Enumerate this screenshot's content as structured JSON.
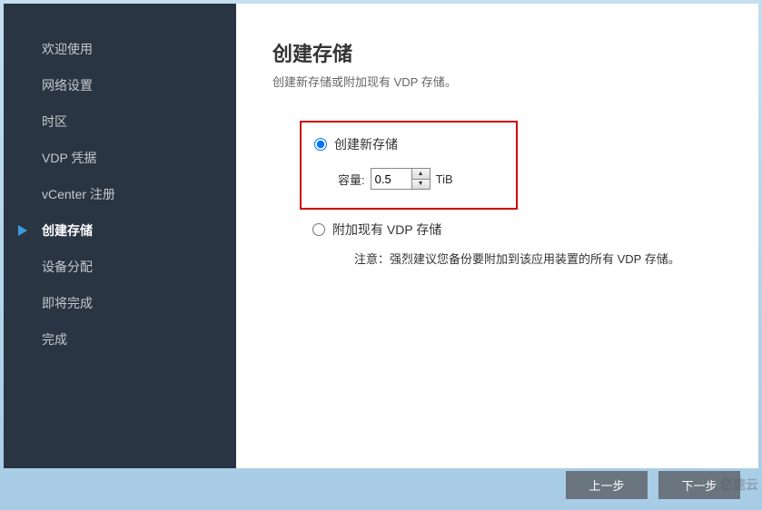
{
  "sidebar": {
    "items": [
      {
        "label": "欢迎使用"
      },
      {
        "label": "网络设置"
      },
      {
        "label": "时区"
      },
      {
        "label": "VDP 凭据"
      },
      {
        "label": "vCenter 注册"
      },
      {
        "label": "创建存储"
      },
      {
        "label": "设备分配"
      },
      {
        "label": "即将完成"
      },
      {
        "label": "完成"
      }
    ],
    "active_index": 5
  },
  "main": {
    "title": "创建存储",
    "subtitle": "创建新存储或附加现有 VDP 存储。",
    "option_create": "创建新存储",
    "capacity_label": "容量:",
    "capacity_value": "0.5",
    "capacity_unit": "TiB",
    "option_attach": "附加现有 VDP 存储",
    "note": "注意：强烈建议您备份要附加到该应用装置的所有 VDP 存储。"
  },
  "buttons": {
    "prev": "上一步",
    "next": "下一步"
  },
  "watermark": {
    "text": "亿速云"
  }
}
